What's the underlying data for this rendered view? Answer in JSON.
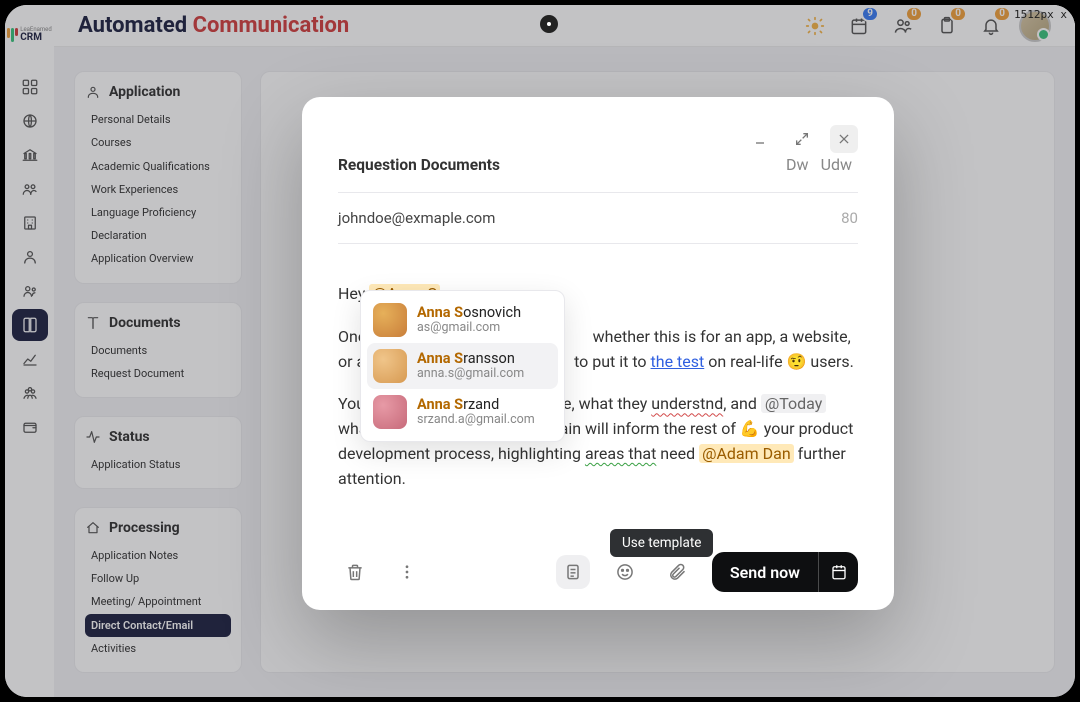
{
  "resize_readout": "1512px x",
  "header": {
    "title_word1": "Automated",
    "title_word2": "Communication",
    "badges": {
      "cal": "9",
      "users": "0",
      "clip": "0",
      "bell": "0"
    }
  },
  "rail": {
    "items": [
      "dashboard",
      "globe",
      "bank",
      "contacts",
      "building",
      "person",
      "people",
      "book",
      "chart",
      "group",
      "wallet"
    ],
    "active_index": 7
  },
  "sidebar": {
    "groups": [
      {
        "title": "Application",
        "icon": "user",
        "items": [
          "Personal Details",
          "Courses",
          "Academic Qualifications",
          "Work Experiences",
          "Language Proficiency",
          "Declaration",
          "Application Overview"
        ],
        "active": -1
      },
      {
        "title": "Documents",
        "icon": "book",
        "items": [
          "Documents",
          "Request Document"
        ],
        "active": -1
      },
      {
        "title": "Status",
        "icon": "activity",
        "items": [
          "Application Status"
        ],
        "active": -1
      },
      {
        "title": "Processing",
        "icon": "home",
        "items": [
          "Application Notes",
          "Follow Up",
          "Meeting/ Appointment",
          "Direct Contact/Email",
          "Activities"
        ],
        "active": 3
      }
    ]
  },
  "modal": {
    "title": "Requestion Documents",
    "dw": "Dw",
    "udw": "Udw",
    "email": "johndoe@exmaple.com",
    "count": "80",
    "greet_pre": "Hey ",
    "greet_mention": "@Anna S",
    "p1_a": "Once",
    "p1_b": "whether this is for an app, a website, or another",
    "p1_c": "to put it to ",
    "p1_link": "the test",
    "p1_d": " on real-life 🤨 users.",
    "p2_a": "You ",
    "p2_b": "ke, what they ",
    "p2_err": "understnd",
    "p2_c": ", and ",
    "p2_chip": "@Today",
    "p2_d": " what they",
    "p2_e": "ou gain will inform the rest of 💪 your product development process, highlighting ",
    "p2_grn": "areas that",
    "p2_f": " need ",
    "p2_mention": "@Adam Dan",
    "p2_g": "  further attention.",
    "tooltip": "Use template",
    "send": "Send now"
  },
  "suggestions": [
    {
      "name_b": "Anna S",
      "name_rest": "osnovich",
      "email": "as@gmail.com",
      "sel": false,
      "bg": "#e6b05a,#c97e3a"
    },
    {
      "name_b": "Anna S",
      "name_rest": "ransson",
      "email": "anna.s@gmail.com",
      "sel": true,
      "bg": "#f0c58a,#d79a52"
    },
    {
      "name_b": "Anna S",
      "name_rest": "rzand",
      "email": "srzand.a@gmail.com",
      "sel": false,
      "bg": "#e79aa6,#c76a7a"
    }
  ]
}
